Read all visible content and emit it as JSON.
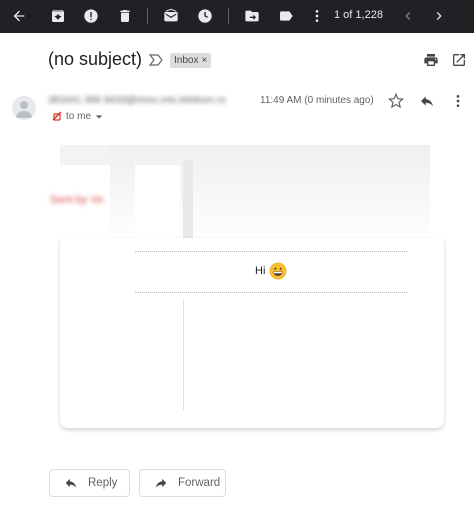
{
  "toolbar": {
    "pagination": "1 of 1,228",
    "icons": [
      "back-arrow-icon",
      "archive-icon",
      "report-spam-icon",
      "delete-icon",
      "mark-unread-icon",
      "snooze-icon",
      "move-to-icon",
      "labels-icon",
      "more-vert-icon",
      "prev-chevron-icon",
      "next-chevron-icon"
    ]
  },
  "header": {
    "subject": "(no subject)",
    "label": "Inbox",
    "label_close": "×"
  },
  "message": {
    "sender_blurred": "381641 368 9433@mms.mts.telekom.rs",
    "time": "11:49 AM (0 minutes ago)",
    "recipient": "to me",
    "body_logo_blurred": "Sent by Vo",
    "body_text": "Hi",
    "emoji": "grinning-face"
  },
  "actions": {
    "reply": "Reply",
    "forward": "Forward"
  },
  "colors": {
    "toolbar_bg": "#202124",
    "toolbar_icon": "#e8eaed",
    "accent_red": "#d93025"
  }
}
